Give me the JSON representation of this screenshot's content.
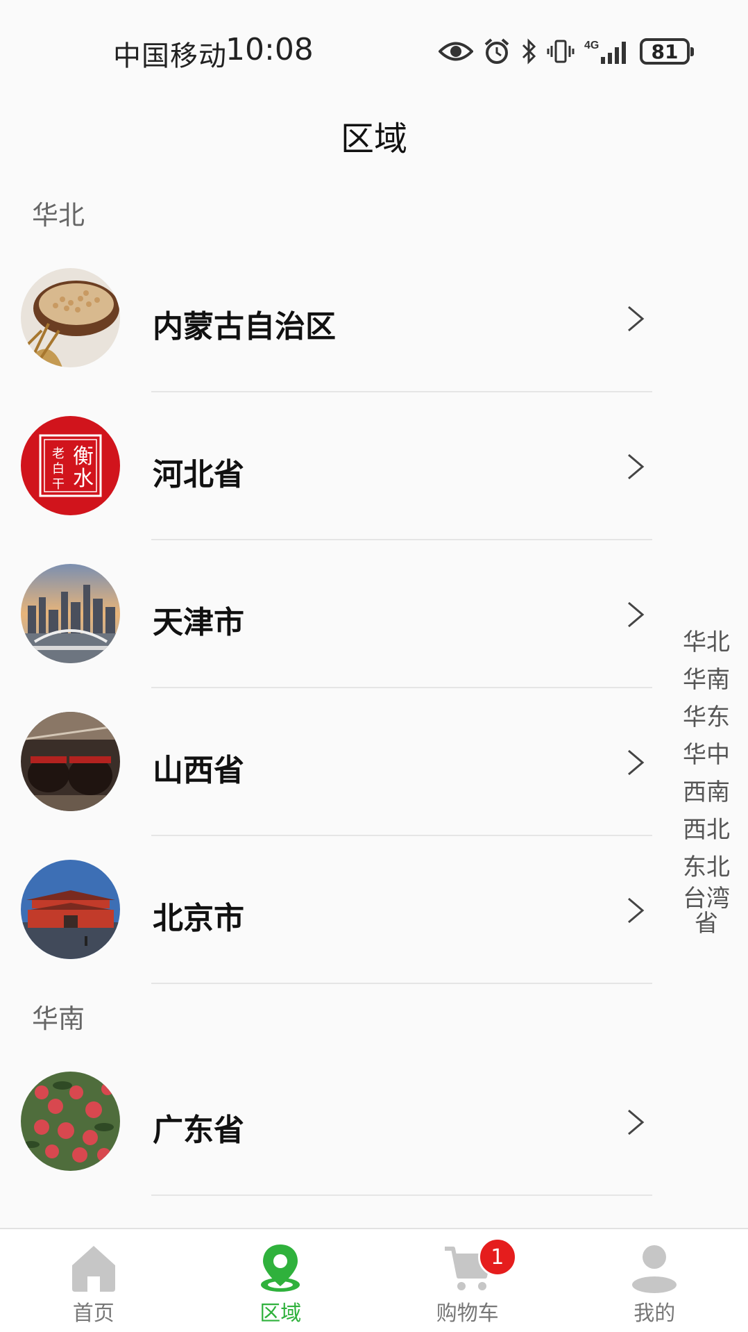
{
  "status_bar": {
    "carrier": "中国移动",
    "time": "10:08",
    "network": "4G",
    "battery": "81"
  },
  "title": "区域",
  "sections": [
    {
      "header": "华北",
      "items": [
        {
          "label": "内蒙古自治区",
          "image": "wheat-bowl"
        },
        {
          "label": "河北省",
          "image": "hengshui-laobaigan-seal",
          "seal_text": "衡水老白干"
        },
        {
          "label": "天津市",
          "image": "tianjin-skyline"
        },
        {
          "label": "山西省",
          "image": "vinegar-jars"
        },
        {
          "label": "北京市",
          "image": "tiananmen"
        }
      ]
    },
    {
      "header": "华南",
      "items": [
        {
          "label": "广东省",
          "image": "lychee"
        }
      ]
    }
  ],
  "index_bar": [
    "华北",
    "华南",
    "华东",
    "华中",
    "西南",
    "西北",
    "东北",
    "台湾省"
  ],
  "tab_bar": {
    "tabs": [
      {
        "label": "首页",
        "icon": "home-icon"
      },
      {
        "label": "区域",
        "icon": "location-pin-icon",
        "active": true
      },
      {
        "label": "购物车",
        "icon": "cart-icon",
        "badge": "1"
      },
      {
        "label": "我的",
        "icon": "user-icon"
      }
    ],
    "active_color": "#2fb13c"
  }
}
